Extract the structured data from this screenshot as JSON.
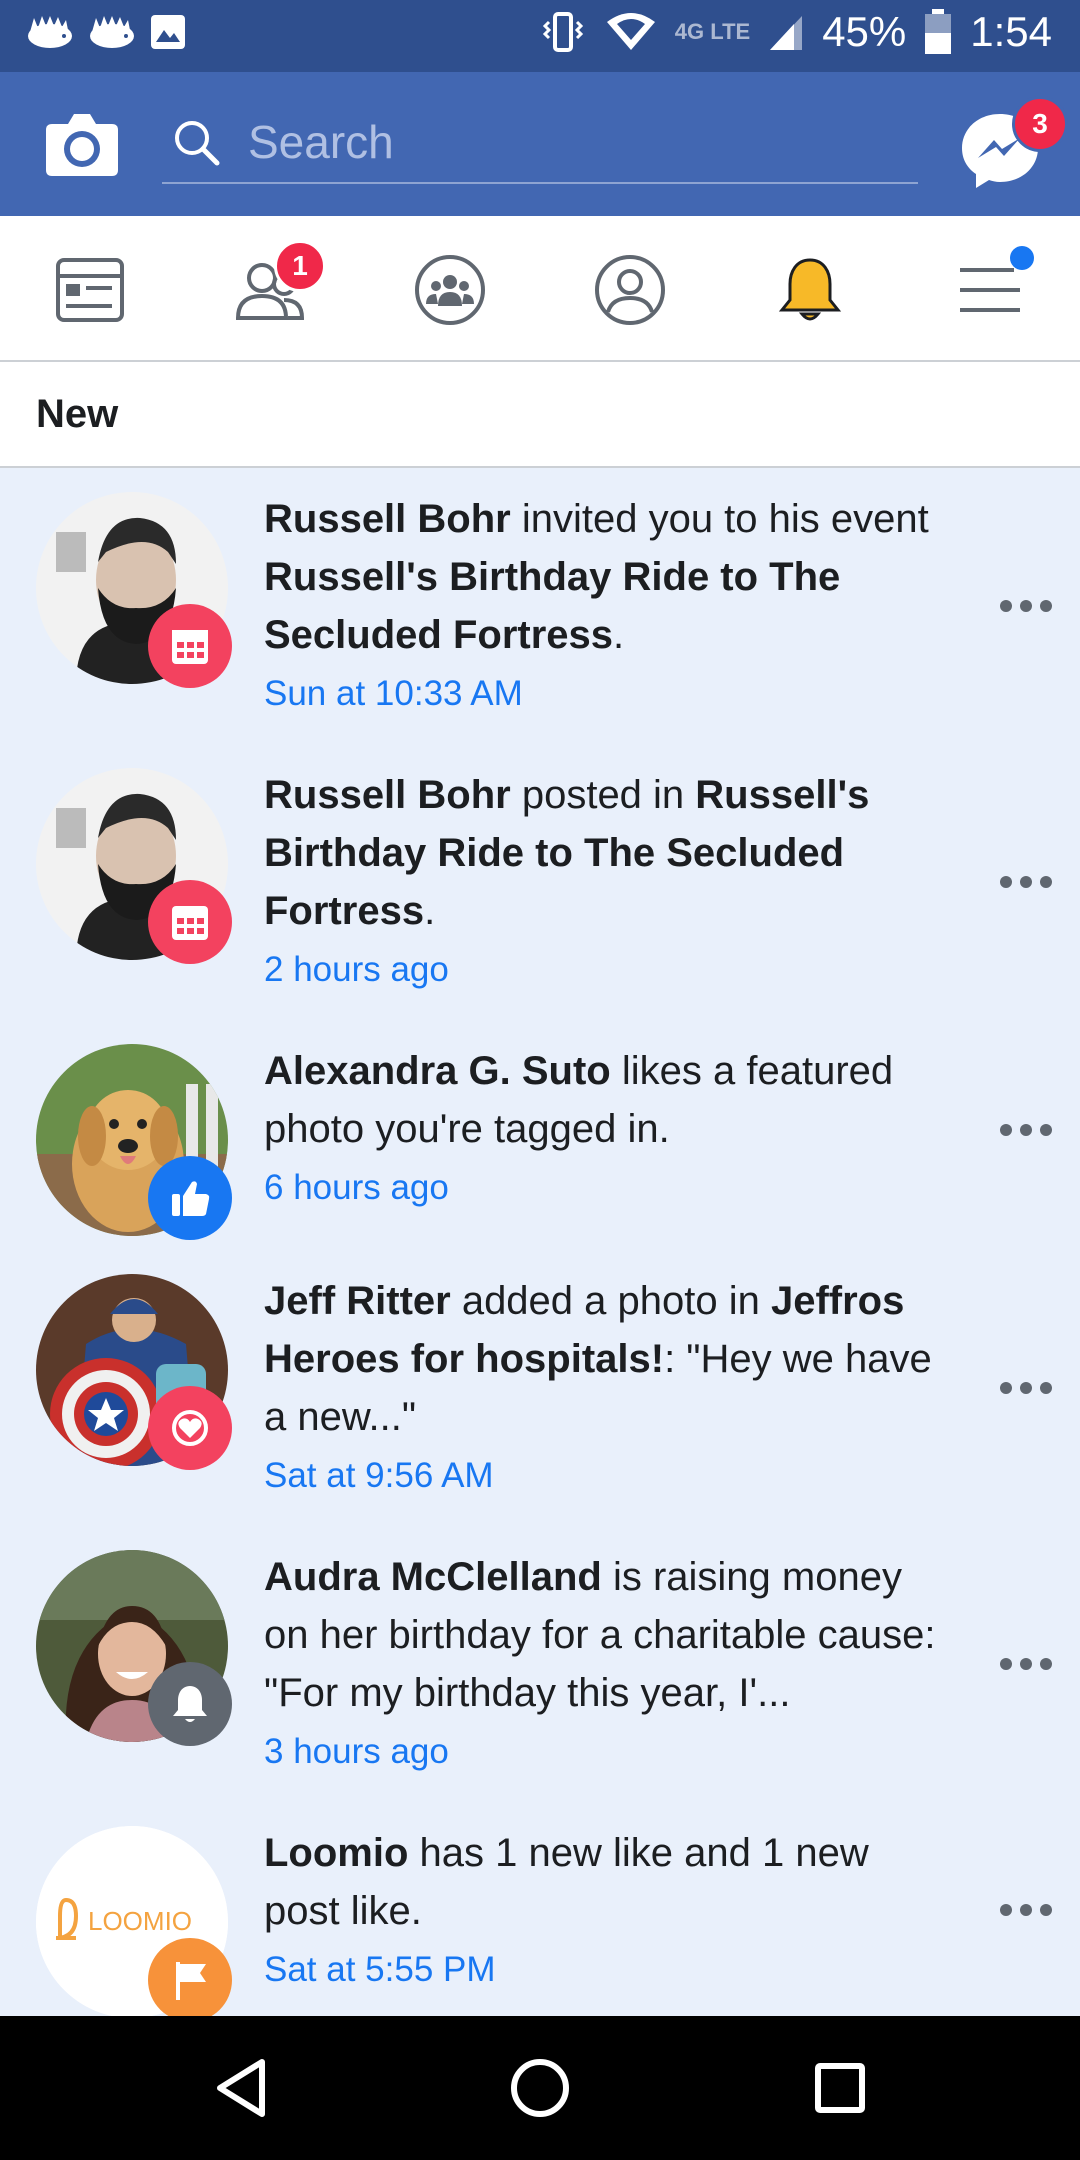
{
  "status_bar": {
    "time": "1:54",
    "battery": "45%",
    "network": "4G LTE"
  },
  "header": {
    "search": {
      "placeholder": "Search"
    },
    "messenger_badge": "3"
  },
  "tabs": [
    {
      "name": "news-feed",
      "icon": "news-feed-icon"
    },
    {
      "name": "friends",
      "icon": "friends-icon",
      "badge": "1"
    },
    {
      "name": "groups",
      "icon": "groups-icon"
    },
    {
      "name": "profile",
      "icon": "profile-icon"
    },
    {
      "name": "notifications",
      "icon": "bell-icon",
      "active": true
    },
    {
      "name": "menu",
      "icon": "menu-icon"
    }
  ],
  "section": {
    "title": "New"
  },
  "notifications": [
    {
      "avatar": "bearded-man-avatar",
      "badge_icon": "calendar-icon",
      "badge_color": "#f3425f",
      "parts": [
        {
          "t": "Russell Bohr",
          "b": true
        },
        {
          "t": " invited you to his event ",
          "b": false
        },
        {
          "t": "Russell's Birthday Ride to The Secluded Fortress",
          "b": true
        },
        {
          "t": ".",
          "b": false
        }
      ],
      "time": "Sun at 10:33 AM"
    },
    {
      "avatar": "bearded-man-avatar",
      "badge_icon": "calendar-icon",
      "badge_color": "#f3425f",
      "parts": [
        {
          "t": "Russell Bohr",
          "b": true
        },
        {
          "t": " posted in ",
          "b": false
        },
        {
          "t": "Russell's Birthday Ride to The Secluded Fortress",
          "b": true
        },
        {
          "t": ".",
          "b": false
        }
      ],
      "time": "2 hours ago"
    },
    {
      "avatar": "dog-avatar",
      "badge_icon": "thumbs-up-icon",
      "badge_color": "#1877f2",
      "parts": [
        {
          "t": "Alexandra G. Suto",
          "b": true
        },
        {
          "t": " likes a featured photo you're tagged in.",
          "b": false
        }
      ],
      "time": "6 hours ago"
    },
    {
      "avatar": "captain-shield-avatar",
      "badge_icon": "heart-icon",
      "badge_color": "#f3425f",
      "parts": [
        {
          "t": "Jeff Ritter",
          "b": true
        },
        {
          "t": " added a photo in ",
          "b": false
        },
        {
          "t": "Jeffros Heroes for hospitals!",
          "b": true
        },
        {
          "t": ": \"Hey we have a new...\"",
          "b": false
        }
      ],
      "time": "Sat at 9:56 AM"
    },
    {
      "avatar": "smiling-woman-avatar",
      "badge_icon": "bell-icon",
      "badge_color": "#606770",
      "parts": [
        {
          "t": "Audra McClelland",
          "b": true
        },
        {
          "t": " is raising money on her birthday for a charitable cause: \"For my birthday this year, I'...",
          "b": false
        }
      ],
      "time": "3 hours ago"
    },
    {
      "avatar": "loomio-logo",
      "logo_text": "LOOMIO",
      "badge_icon": "flag-icon",
      "badge_color": "#f7923a",
      "parts": [
        {
          "t": "Loomio",
          "b": true
        },
        {
          "t": " has 1 new like and 1 new post like.",
          "b": false
        }
      ],
      "time": "Sat at 5:55 PM"
    }
  ],
  "colors": {
    "header": "#4267b2",
    "status_bar": "#2f4f8e",
    "unread_bg": "#e9f0fb",
    "link": "#1877f2",
    "badge": "#f02849"
  }
}
